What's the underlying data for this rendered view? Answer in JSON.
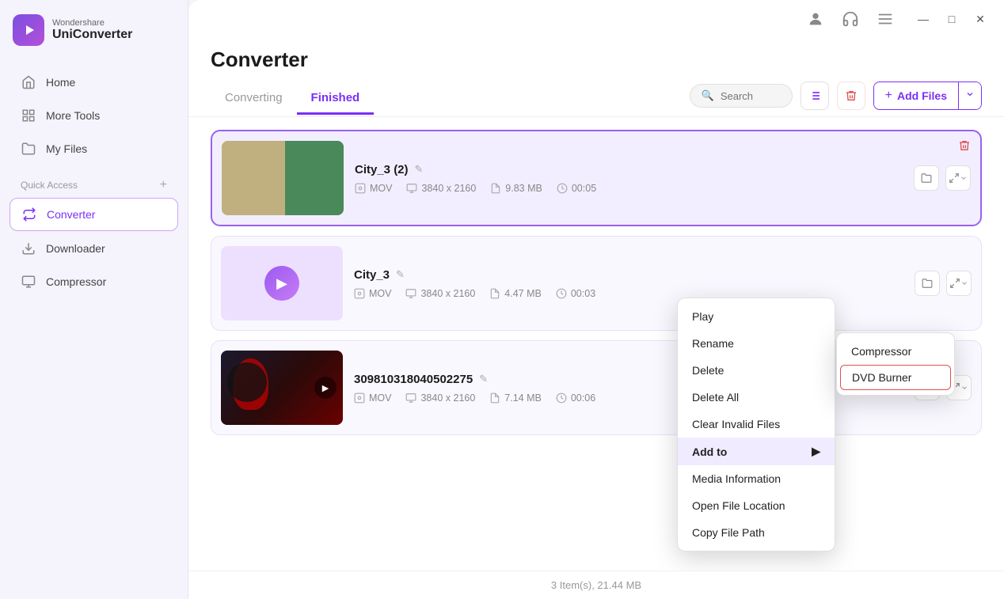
{
  "app": {
    "brand": "Wondershare",
    "name": "UniConverter"
  },
  "sidebar": {
    "items": [
      {
        "id": "home",
        "label": "Home",
        "icon": "home"
      },
      {
        "id": "more-tools",
        "label": "More Tools",
        "icon": "grid"
      },
      {
        "id": "my-files",
        "label": "My Files",
        "icon": "folder"
      }
    ],
    "quick_access_label": "Quick Access",
    "quick_access_plus": "+",
    "converter_label": "Converter",
    "downloader_label": "Downloader",
    "compressor_label": "Compressor"
  },
  "page": {
    "title": "Converter"
  },
  "tabs": {
    "converting": "Converting",
    "finished": "Finished"
  },
  "toolbar": {
    "search_placeholder": "Search",
    "add_files_label": "Add Files"
  },
  "files": [
    {
      "id": "city3-2",
      "name": "City_3 (2)",
      "format": "MOV",
      "resolution": "3840 x 2160",
      "size": "9.83 MB",
      "duration": "00:05",
      "selected": true,
      "thumb_type": "photo"
    },
    {
      "id": "city3",
      "name": "City_3",
      "format": "MOV",
      "resolution": "3840 x 2160",
      "size": "4.47 MB",
      "duration": "00:03",
      "selected": false,
      "thumb_type": "purple"
    },
    {
      "id": "long-id",
      "name": "309810318040502275",
      "format": "MOV",
      "resolution": "3840 x 2160",
      "size": "7.14 MB",
      "duration": "00:06",
      "selected": false,
      "thumb_type": "venom"
    }
  ],
  "context_menu": {
    "items": [
      {
        "label": "Play",
        "has_arrow": false
      },
      {
        "label": "Rename",
        "has_arrow": false
      },
      {
        "label": "Delete",
        "has_arrow": false
      },
      {
        "label": "Delete All",
        "has_arrow": false
      },
      {
        "label": "Clear Invalid Files",
        "has_arrow": false
      },
      {
        "label": "Add to",
        "has_arrow": true,
        "active": true
      },
      {
        "label": "Media Information",
        "has_arrow": false
      },
      {
        "label": "Open File Location",
        "has_arrow": false
      },
      {
        "label": "Copy File Path",
        "has_arrow": false
      }
    ]
  },
  "submenu": {
    "items": [
      {
        "label": "Compressor",
        "highlighted": false
      },
      {
        "label": "DVD Burner",
        "highlighted": true
      }
    ]
  },
  "status_bar": {
    "text": "3 Item(s), 21.44 MB"
  }
}
